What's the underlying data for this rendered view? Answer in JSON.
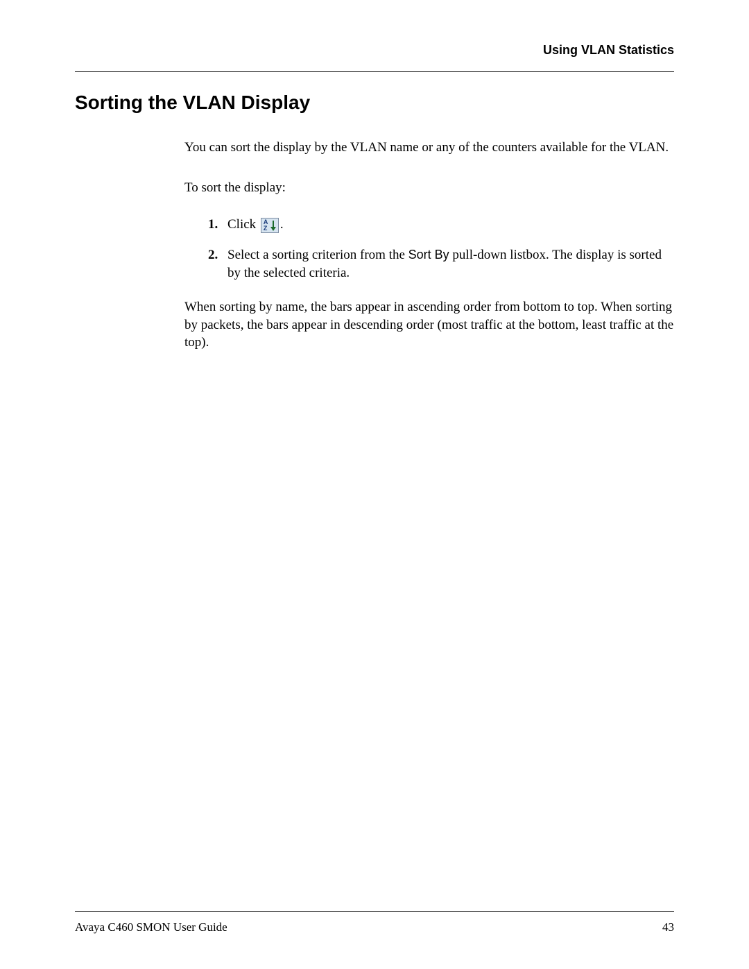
{
  "header": {
    "running_head": "Using VLAN Statistics"
  },
  "section": {
    "title": "Sorting the VLAN Display"
  },
  "body": {
    "intro": "You can sort the display by the VLAN name or any of the counters available for the VLAN.",
    "lead": "To sort the display:",
    "steps": [
      {
        "num": "1.",
        "prefix": "Click ",
        "icon": "sort-az-icon",
        "suffix": "."
      },
      {
        "num": "2.",
        "text_before": "Select a sorting criterion from the ",
        "ui_term": "Sort By",
        "text_after": " pull-down listbox. The display is sorted by the selected criteria."
      }
    ],
    "closing": "When sorting by name, the bars appear in ascending order from bottom to top. When sorting by packets, the bars appear in descending order (most traffic at the bottom, least traffic at the top)."
  },
  "footer": {
    "doc_title": "Avaya C460 SMON User Guide",
    "page_number": "43"
  }
}
